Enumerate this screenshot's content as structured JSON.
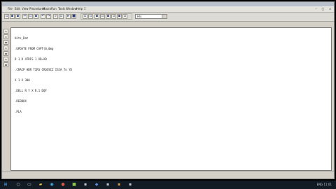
{
  "window": {
    "title": "",
    "controls": {
      "minimize": "–",
      "maximize": "□",
      "close": "x"
    }
  },
  "menu": [
    "File",
    "Edit",
    "View",
    "Procedures",
    "Macro",
    "Run",
    "Tools",
    "Window",
    "Help",
    "Ξ"
  ],
  "toolbar": {
    "font_combo_value": "Hls"
  },
  "editor": {
    "lines": [
      "Hits_Dat",
      ".UPDATE FROM CAPT(0,0mg",
      "D 1 D 4TRIS 1 XD=XD",
      ".CRACP HDR TIRS CROSSIZ ISJA To YD",
      "X 1 X 300",
      ".DELL R Y X R.1 DQF",
      ".REBBOX",
      ".PLA"
    ]
  },
  "taskbar": {
    "icons": [
      "start-icon",
      "search-icon",
      "task-view-icon",
      "folder-icon",
      "browser-icon",
      "app-icon",
      "app-icon",
      "app-icon",
      "app-icon",
      "app-icon",
      "app-icon",
      "app-icon"
    ],
    "tray_text": "ENG  11:01"
  }
}
